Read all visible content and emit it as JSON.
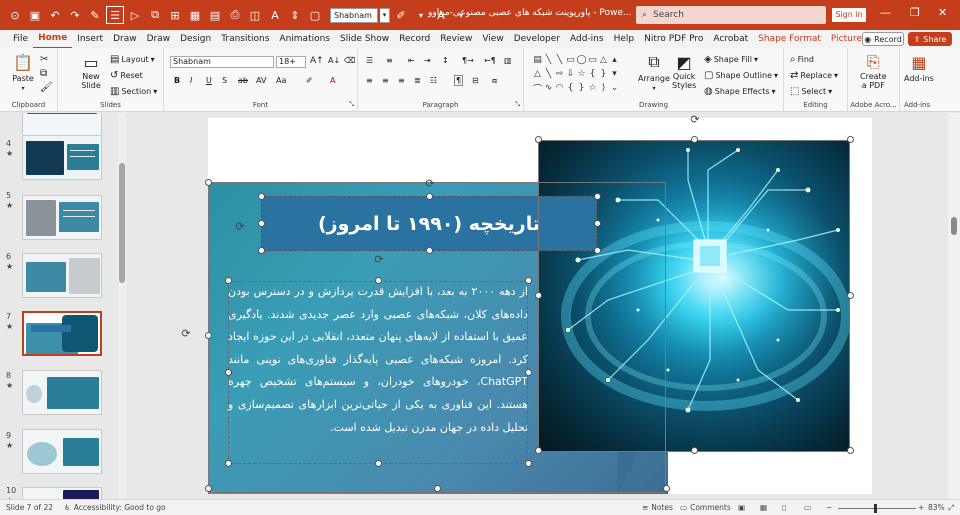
{
  "window": {
    "doc_title": "پاورپوینت شبکه های عصبی مصنوعی-میناوو - Powe...",
    "search_placeholder": "Search",
    "signin_label": "Sign in",
    "quick_font": "Shabnam",
    "accent_color": "#c43e1c"
  },
  "tabs": [
    {
      "label": "File"
    },
    {
      "label": "Home"
    },
    {
      "label": "Insert"
    },
    {
      "label": "Draw"
    },
    {
      "label": "Draw"
    },
    {
      "label": "Design"
    },
    {
      "label": "Transitions"
    },
    {
      "label": "Animations"
    },
    {
      "label": "Slide Show"
    },
    {
      "label": "Record"
    },
    {
      "label": "Review"
    },
    {
      "label": "View"
    },
    {
      "label": "Developer"
    },
    {
      "label": "Add-ins"
    },
    {
      "label": "Help"
    },
    {
      "label": "Nitro PDF Pro"
    },
    {
      "label": "Acrobat"
    },
    {
      "label": "Shape Format"
    },
    {
      "label": "Picture Format"
    }
  ],
  "record_label": "Record",
  "share_label": "Share",
  "ribbon": {
    "clipboard": {
      "label": "Clipboard",
      "paste": "Paste"
    },
    "slides": {
      "label": "Slides",
      "new_slide": "New",
      "new_slide2": "Slide",
      "layout": "Layout",
      "reset": "Reset",
      "section": "Section"
    },
    "font": {
      "label": "Font",
      "family": "Shabnam",
      "size": "18+"
    },
    "paragraph": {
      "label": "Paragraph"
    },
    "drawing": {
      "label": "Drawing",
      "arrange": "Arrange",
      "quick_styles": "Quick",
      "quick_styles2": "Styles",
      "shape_fill": "Shape Fill",
      "shape_outline": "Shape Outline",
      "shape_effects": "Shape Effects"
    },
    "editing": {
      "label": "Editing",
      "find": "Find",
      "replace": "Replace",
      "select": "Select"
    },
    "adobe": {
      "label": "Adobe Acro...",
      "create_pdf": "Create",
      "create_pdf2": "a PDF"
    },
    "addins": {
      "label": "Add-ins",
      "addins_btn": "Add-ins"
    }
  },
  "thumbnails": [
    {
      "num": "4",
      "star": "★"
    },
    {
      "num": "5",
      "star": "★"
    },
    {
      "num": "6",
      "star": "★"
    },
    {
      "num": "7",
      "star": "★"
    },
    {
      "num": "8",
      "star": "★"
    },
    {
      "num": "9",
      "star": "★"
    },
    {
      "num": "10",
      "star": "★"
    }
  ],
  "slide": {
    "title": "تاریخچه (۱۹۹۰ تا امروز)",
    "body": "از دهه ۲۰۰۰ به بعد، با افزایش قدرت پردازش و در دسترس بودن داده‌های کلان، شبکه‌های عصبی وارد عصر جدیدی شدند. یادگیری عمیق با استفاده از لایه‌های پنهان متعدد، انقلابی در این حوزه ایجاد کرد. امروزه شبکه‌های عصبی پایه‌گذار فناوری‌های نوینی مانند ChatGPT، خودروهای خودران، و سیستم‌های تشخیص چهره هستند. این فناوری به یکی از حیاتی‌ترین ابزارهای تصمیم‌سازی و تحلیل داده در جهان مدرن تبدیل شده است."
  },
  "status": {
    "slide_of": "Slide 7 of 22",
    "accessibility": "Accessibility: Good to go",
    "notes": "Notes",
    "comments": "Comments",
    "zoom": "83%"
  }
}
